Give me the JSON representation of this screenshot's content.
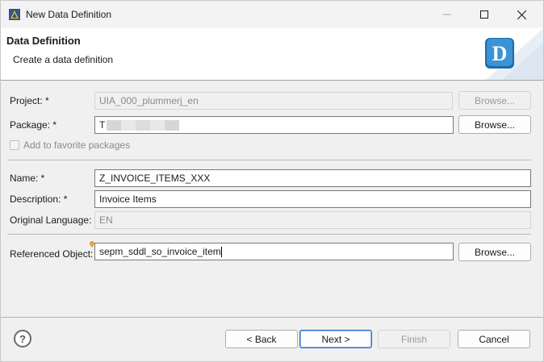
{
  "window": {
    "title": "New Data Definition",
    "icon": "eclipse-adt-icon"
  },
  "header": {
    "title": "Data Definition",
    "subtitle": "Create a data definition",
    "logo_letter": "D"
  },
  "form": {
    "project": {
      "label": "Project: *",
      "value": "UIA_000_plummerj_en",
      "browse_label": "Browse..."
    },
    "package": {
      "label": "Package: *",
      "value": "T",
      "browse_label": "Browse..."
    },
    "favorite": {
      "label": "Add to favorite packages",
      "checked": false
    },
    "name": {
      "label": "Name: *",
      "value": "Z_INVOICE_ITEMS_XXX"
    },
    "description": {
      "label": "Description: *",
      "value": "Invoice Items"
    },
    "language": {
      "label": "Original Language:",
      "value": "EN"
    },
    "referenced": {
      "label": "Referenced Object:",
      "value": "sepm_sddl_so_invoice_item",
      "browse_label": "Browse..."
    }
  },
  "footer": {
    "help": "?",
    "back": "< Back",
    "next": "Next >",
    "finish": "Finish",
    "cancel": "Cancel"
  },
  "colors": {
    "accent": "#2c6ac4",
    "logo": "#2f86c8"
  }
}
